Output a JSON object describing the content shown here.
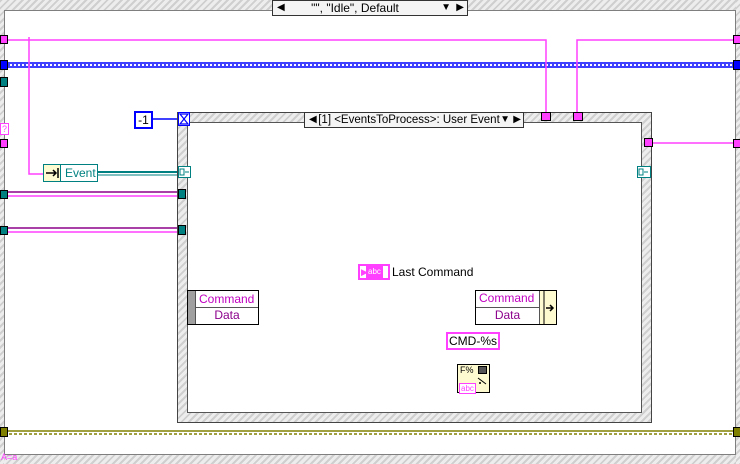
{
  "case_selector": {
    "label": "\"\", \"Idle\", Default"
  },
  "event_structure": {
    "selector_label": "[1] <EventsToProcess>: User Event"
  },
  "timeout_constant": {
    "value": "-1"
  },
  "event_refnum": {
    "label": "Event"
  },
  "event_data_node": {
    "command_label": "Command",
    "data_label": "Data"
  },
  "bundle_node": {
    "command_label": "Command",
    "data_label": "Data"
  },
  "indicator": {
    "type_label": "abc",
    "name": "Last Command"
  },
  "format_string_constant": {
    "value": "CMD-%s"
  },
  "format_into_string": {
    "glyph": "F%",
    "output_label": "abc"
  },
  "tunnel_glyph": "→",
  "bottom_left_label": "A=a",
  "left_edge_label": "?",
  "colors": {
    "string_wire": "#ff40ff",
    "cluster_wire": "#8b008b",
    "refnum_wire": "#008080",
    "error_wire": "#808000",
    "numeric_wire": "#0000ff",
    "structure_border": "#7f7f7f"
  }
}
